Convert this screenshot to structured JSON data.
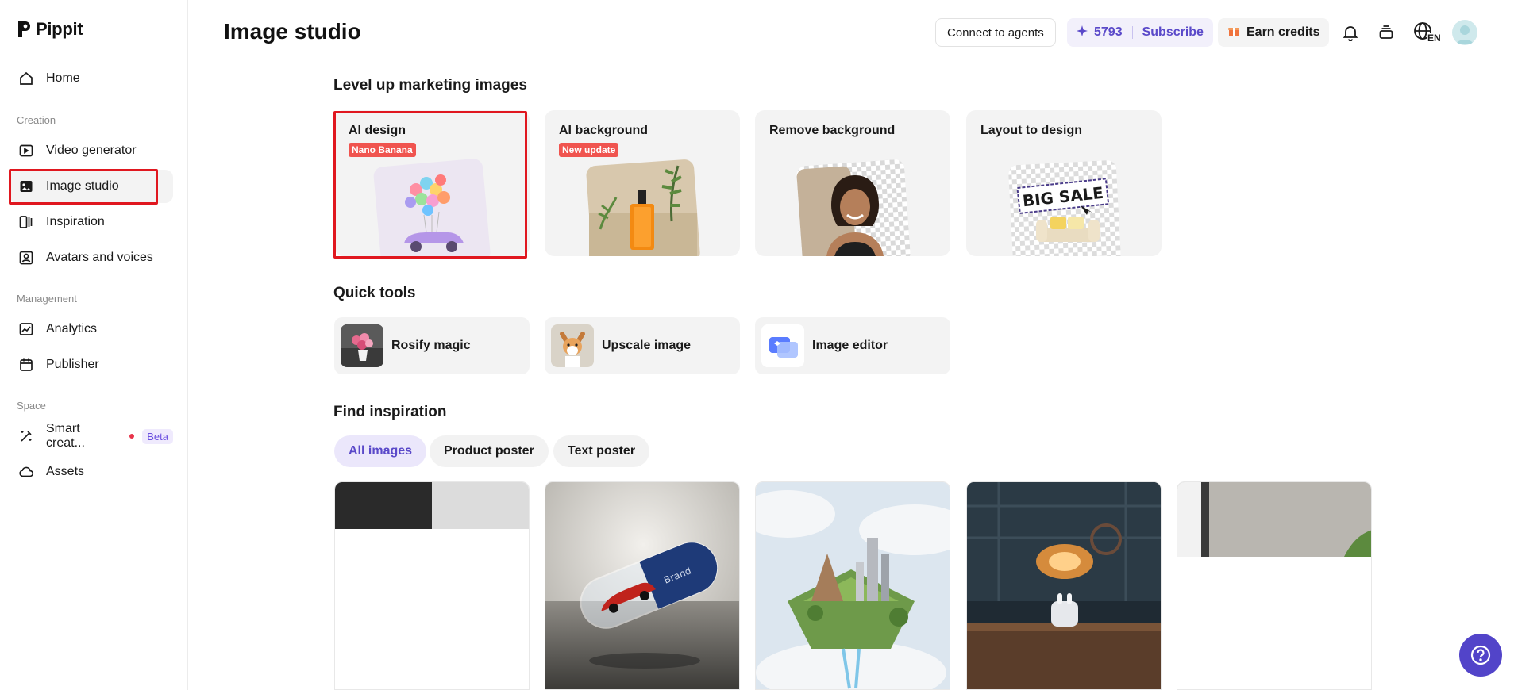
{
  "app": {
    "name": "Pippit"
  },
  "sidebar": {
    "home": "Home",
    "sections": {
      "creation": "Creation",
      "management": "Management",
      "space": "Space"
    },
    "items": [
      {
        "label": "Video generator"
      },
      {
        "label": "Image studio"
      },
      {
        "label": "Inspiration"
      },
      {
        "label": "Avatars and voices"
      },
      {
        "label": "Analytics"
      },
      {
        "label": "Publisher"
      },
      {
        "label": "Smart creat...",
        "badge": "Beta"
      },
      {
        "label": "Assets"
      }
    ]
  },
  "header": {
    "title": "Image studio",
    "connect_label": "Connect to agents",
    "credits": "5793",
    "subscribe_label": "Subscribe",
    "earn_label": "Earn credits",
    "language": "EN"
  },
  "marketing": {
    "title": "Level up marketing images",
    "cards": [
      {
        "title": "AI design",
        "badge": "Nano Banana"
      },
      {
        "title": "AI background",
        "badge": "New update"
      },
      {
        "title": "Remove background"
      },
      {
        "title": "Layout to design",
        "art_text": "BIG SALE"
      }
    ]
  },
  "quick_tools": {
    "title": "Quick tools",
    "items": [
      {
        "label": "Rosify magic"
      },
      {
        "label": "Upscale image"
      },
      {
        "label": "Image editor"
      }
    ]
  },
  "inspiration": {
    "title": "Find inspiration",
    "filters": [
      {
        "label": "All images",
        "active": true
      },
      {
        "label": "Product poster"
      },
      {
        "label": "Text poster"
      }
    ],
    "gallery_art_text": "Brand"
  },
  "colors": {
    "accent": "#5a49c9",
    "highlight": "#e0171f",
    "badge": "#f0544f"
  }
}
